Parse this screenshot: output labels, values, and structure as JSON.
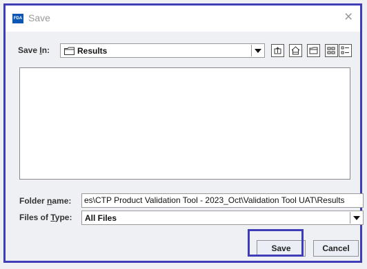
{
  "window": {
    "icon_text": "FDA",
    "title": "Save",
    "close_glyph": "×"
  },
  "save_in": {
    "label": "Save In:",
    "mnemonic": "I",
    "label_prefix": "Save ",
    "label_suffix": "n:",
    "value": "Results",
    "icon": "folder-icon"
  },
  "toolbar": {
    "buttons": [
      {
        "name": "up-one-level-icon"
      },
      {
        "name": "home-folder-icon"
      },
      {
        "name": "new-folder-icon"
      },
      {
        "name": "list-view-icon"
      },
      {
        "name": "details-view-icon"
      }
    ]
  },
  "folder_name": {
    "label_prefix": "Folder ",
    "label_mnemonic": "n",
    "label_suffix": "ame:",
    "value": "es\\CTP Product Validation Tool - 2023_Oct\\Validation Tool UAT\\Results"
  },
  "files_of_type": {
    "label_prefix": "Files of ",
    "label_mnemonic": "T",
    "label_suffix": "ype:",
    "value": "All Files"
  },
  "buttons": {
    "save": "Save",
    "cancel": "Cancel"
  },
  "colors": {
    "highlight": "#3f3cb8",
    "brand": "#0b56b3"
  }
}
